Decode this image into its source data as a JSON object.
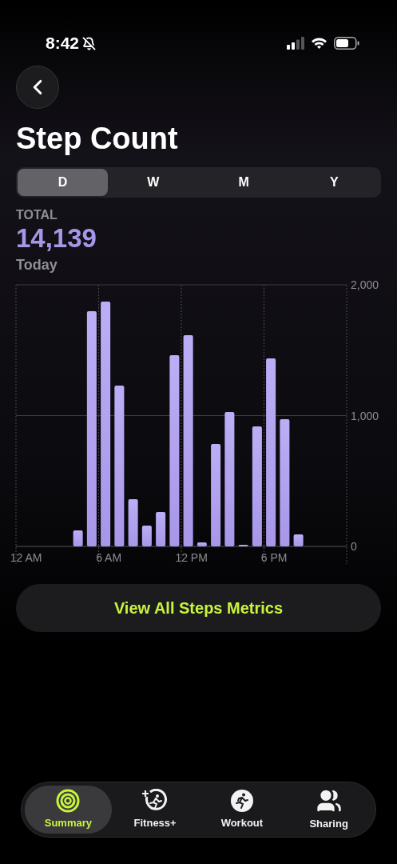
{
  "status_bar": {
    "time": "8:42"
  },
  "title": "Step Count",
  "segments": [
    {
      "label": "D",
      "selected": true
    },
    {
      "label": "W",
      "selected": false
    },
    {
      "label": "M",
      "selected": false
    },
    {
      "label": "Y",
      "selected": false
    }
  ],
  "total": {
    "label": "TOTAL",
    "value": "14,139",
    "period": "Today"
  },
  "chart_data": {
    "type": "bar",
    "categories": [
      "12 AM",
      null,
      null,
      null,
      null,
      null,
      "6 AM",
      null,
      null,
      null,
      null,
      null,
      "12 PM",
      null,
      null,
      null,
      null,
      null,
      "6 PM",
      null,
      null,
      null,
      null,
      null
    ],
    "series": [
      {
        "color": "#a896e8",
        "values": [
          0,
          0,
          0,
          0,
          122,
          1798,
          1872,
          1229,
          361,
          159,
          263,
          1462,
          1615,
          31,
          783,
          1028,
          12,
          917,
          1437,
          972,
          92,
          0,
          0,
          0
        ]
      }
    ],
    "ylim": [
      0,
      2000
    ],
    "ref_lines": [
      {
        "axis": "y",
        "value": 1000
      }
    ],
    "yticks": [
      {
        "value": 0,
        "label": "0"
      },
      {
        "value": 1000,
        "label": "1,000"
      },
      {
        "value": 2000,
        "label": "2,000"
      }
    ]
  },
  "button": "View All Steps Metrics",
  "tab_bar": [
    {
      "kind": "rings",
      "label": "Summary",
      "selected": true
    },
    {
      "kind": "fitness",
      "label": "Fitness+",
      "selected": false
    },
    {
      "kind": "workout",
      "label": "Workout",
      "selected": false
    },
    {
      "kind": "sharing",
      "label": "Sharing",
      "selected": false
    }
  ]
}
